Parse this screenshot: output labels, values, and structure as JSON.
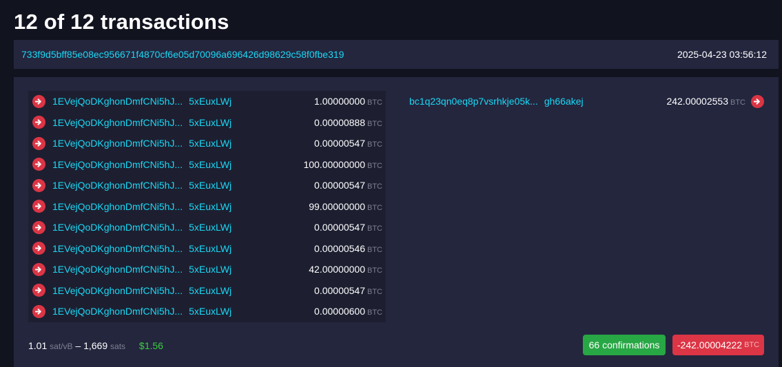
{
  "title": "12 of 12 transactions",
  "txid": "733f9d5bff85e08ec956671f4870cf6e05d70096a696426d98629c58f0fbe319",
  "timestamp": "2025-04-23 03:56:12",
  "unit": "BTC",
  "inputs": [
    {
      "addr_start": "1EVejQoDKghonDmfCNi5hJ...",
      "addr_end": "5xEuxLWj",
      "amount": "1.00000000"
    },
    {
      "addr_start": "1EVejQoDKghonDmfCNi5hJ...",
      "addr_end": "5xEuxLWj",
      "amount": "0.00000888"
    },
    {
      "addr_start": "1EVejQoDKghonDmfCNi5hJ...",
      "addr_end": "5xEuxLWj",
      "amount": "0.00000547"
    },
    {
      "addr_start": "1EVejQoDKghonDmfCNi5hJ...",
      "addr_end": "5xEuxLWj",
      "amount": "100.00000000"
    },
    {
      "addr_start": "1EVejQoDKghonDmfCNi5hJ...",
      "addr_end": "5xEuxLWj",
      "amount": "0.00000547"
    },
    {
      "addr_start": "1EVejQoDKghonDmfCNi5hJ...",
      "addr_end": "5xEuxLWj",
      "amount": "99.00000000"
    },
    {
      "addr_start": "1EVejQoDKghonDmfCNi5hJ...",
      "addr_end": "5xEuxLWj",
      "amount": "0.00000547"
    },
    {
      "addr_start": "1EVejQoDKghonDmfCNi5hJ...",
      "addr_end": "5xEuxLWj",
      "amount": "0.00000546"
    },
    {
      "addr_start": "1EVejQoDKghonDmfCNi5hJ...",
      "addr_end": "5xEuxLWj",
      "amount": "42.00000000"
    },
    {
      "addr_start": "1EVejQoDKghonDmfCNi5hJ...",
      "addr_end": "5xEuxLWj",
      "amount": "0.00000547"
    },
    {
      "addr_start": "1EVejQoDKghonDmfCNi5hJ...",
      "addr_end": "5xEuxLWj",
      "amount": "0.00000600"
    }
  ],
  "outputs": [
    {
      "addr_start": "bc1q23qn0eq8p7vsrhkje05k...",
      "addr_end": "gh66akej",
      "amount": "242.00002553"
    }
  ],
  "footer": {
    "fee_rate": "1.01",
    "fee_rate_unit": "sat/vB",
    "separator": "–",
    "fee": "1,669",
    "fee_unit": "sats",
    "fiat": "$1.56",
    "confirmations": "66 confirmations",
    "net_amount": "-242.00004222"
  },
  "icons": {
    "io_arrow": "arrow-right-circle-icon"
  },
  "colors": {
    "background": "#11131f",
    "panel": "#24263e",
    "inputs_panel": "#1d1f31",
    "link": "#1bd8f4",
    "arrow": "#dc3545",
    "confirmations": "#28a745",
    "net_amount": "#dc3545",
    "fiat": "#3bcd3f"
  }
}
